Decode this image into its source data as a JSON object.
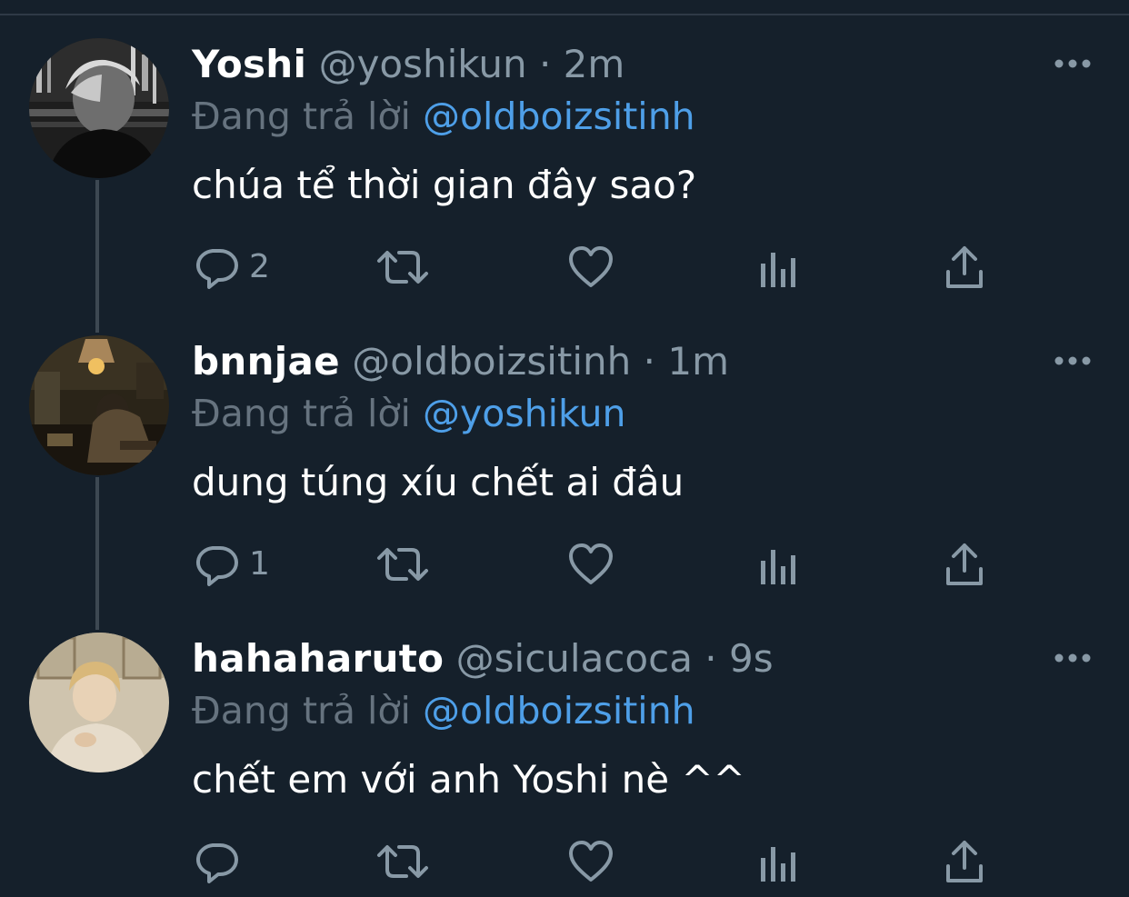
{
  "tweets": [
    {
      "name": "Yoshi",
      "handle": "@yoshikun",
      "separator": "·",
      "time": "2m",
      "replying_label": "Đang trả lời",
      "replying_to": "@oldboizsitinh",
      "text": "chúa tể thời gian đây sao?",
      "reply_count": "2",
      "avatar_desc": "grayscale-photo"
    },
    {
      "name": "bnnjae",
      "handle": "@oldboizsitinh",
      "separator": "·",
      "time": "1m",
      "replying_label": "Đang trả lời",
      "replying_to": "@yoshikun",
      "text": "dung túng xíu chết ai đâu",
      "reply_count": "1",
      "avatar_desc": "warm-lamp-photo"
    },
    {
      "name": "hahaharuto",
      "handle": "@siculacoca",
      "separator": "·",
      "time": "9s",
      "replying_label": "Đang trả lời",
      "replying_to": "@oldboizsitinh",
      "text": "chết em với anh Yoshi nè ^^",
      "reply_count": "",
      "avatar_desc": "beige-portrait-photo"
    }
  ],
  "icons": {
    "reply": "reply-icon",
    "retweet": "retweet-icon",
    "like": "like-icon",
    "analytics": "analytics-icon",
    "share": "share-icon",
    "more": "more-icon"
  },
  "colors": {
    "background": "#15202b",
    "text": "#ffffff",
    "secondary": "#8899a6",
    "link": "#4e9fe8",
    "thread_line": "#3d4852"
  }
}
